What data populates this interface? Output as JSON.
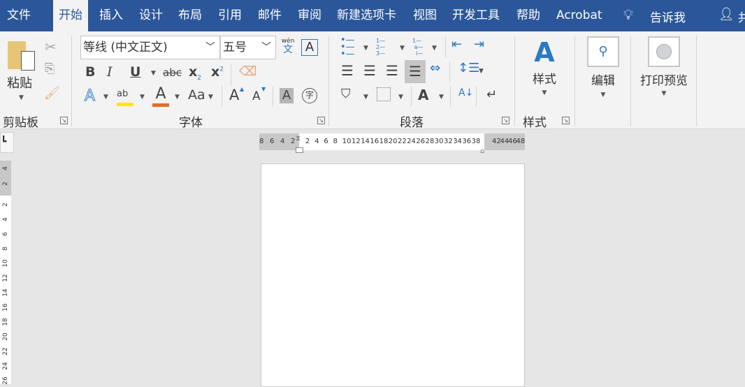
{
  "menubar": {
    "tabs": [
      "文件",
      "开始",
      "插入",
      "设计",
      "布局",
      "引用",
      "邮件",
      "审阅",
      "新建选项卡",
      "视图",
      "开发工具",
      "帮助",
      "Acrobat"
    ],
    "tell_me": "告诉我",
    "share": "共"
  },
  "clipboard": {
    "paste": "粘贴",
    "group": "剪贴板"
  },
  "font": {
    "font_name": "等线 (中文正文)",
    "font_size": "五号",
    "phonetic_top": "wén",
    "phonetic_bottom": "文",
    "bold": "B",
    "italic": "I",
    "underline": "U",
    "strike": "abc",
    "subscript": "x",
    "sub2": "2",
    "superscript": "x",
    "sup2": "2",
    "change_case": "Aa",
    "grow": "A",
    "shrink": "A",
    "shade": "A",
    "enclose": "字",
    "text_effect": "A",
    "font_color": "A",
    "highlight": "ab",
    "group": "字体",
    "highlight_color": "#ffe600",
    "font_color_value": "#e36c2b"
  },
  "paragraph": {
    "group": "段落"
  },
  "styles": {
    "label": "样式",
    "group": "样式"
  },
  "editing": {
    "label": "编辑"
  },
  "print_preview": {
    "label": "打印预览"
  },
  "ruler": {
    "left": [
      "8",
      "6",
      "4",
      "2"
    ],
    "main": [
      "2",
      "4",
      "6",
      "8",
      "10",
      "12",
      "14",
      "16",
      "18",
      "20",
      "22",
      "24",
      "26",
      "28",
      "30",
      "32",
      "34",
      "36",
      "38"
    ],
    "right": [
      "42",
      "44",
      "46",
      "48"
    ],
    "vertical_top": [
      "4",
      "2"
    ],
    "vertical": [
      "2",
      "4",
      "6",
      "8",
      "10",
      "12",
      "14",
      "16",
      "18",
      "20",
      "22",
      "24",
      "26"
    ]
  },
  "colors": {
    "accent": "#2b579a"
  }
}
